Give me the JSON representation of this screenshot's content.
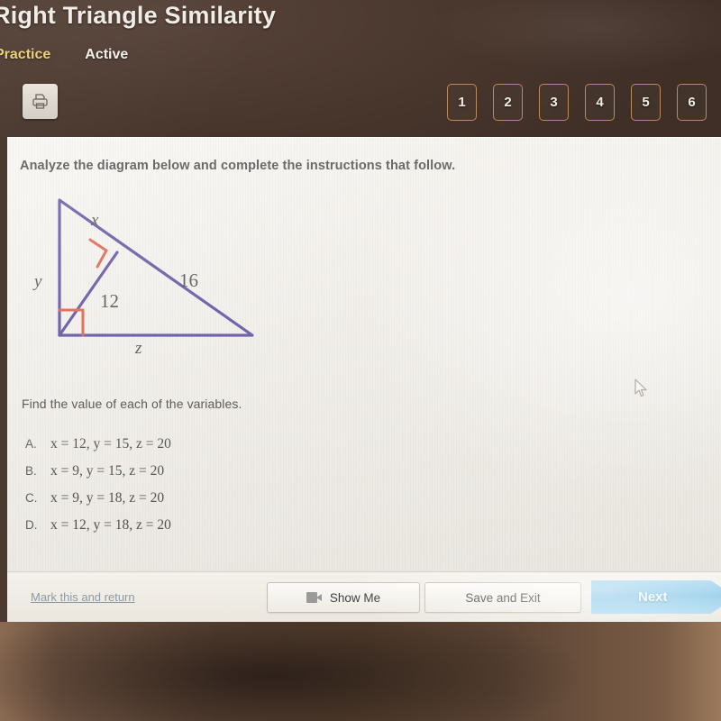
{
  "header": {
    "lesson_title": "Right Triangle Similarity",
    "tabs": [
      {
        "label": "Practice",
        "color": "#e8cf72"
      },
      {
        "label": "Active",
        "color": "#f4f0ec"
      }
    ],
    "print_icon": "printer-icon",
    "pager": [
      "1",
      "2",
      "3",
      "4",
      "5",
      "6"
    ]
  },
  "content": {
    "instructions": "Analyze the diagram below and complete the instructions that follow.",
    "prompt": "Find the value of each of the variables.",
    "choices": [
      {
        "letter": "A.",
        "text": "x = 12, y = 15, z = 20"
      },
      {
        "letter": "B.",
        "text": "x = 9, y = 15, z = 20"
      },
      {
        "letter": "C.",
        "text": "x = 9, y = 18, z = 20"
      },
      {
        "letter": "D.",
        "text": "x = 12, y = 18, z = 20"
      }
    ]
  },
  "diagram": {
    "type": "right-triangle-with-altitude",
    "line_color": "#5b4a9e",
    "right_angle_color": "#e05a42",
    "labels": {
      "hypotenuse_upper": "x",
      "left_leg": "y",
      "hypotenuse_lower": "16",
      "altitude": "12",
      "base": "z"
    },
    "right_angle_marks": 2
  },
  "toolbar": {
    "mark_return_label": "Mark this and return",
    "show_me_label": "Show Me",
    "show_me_icon": "video-camera-icon",
    "save_exit_label": "Save and Exit",
    "next_label": "Next"
  },
  "cursor": {
    "icon": "mouse-pointer-icon"
  }
}
